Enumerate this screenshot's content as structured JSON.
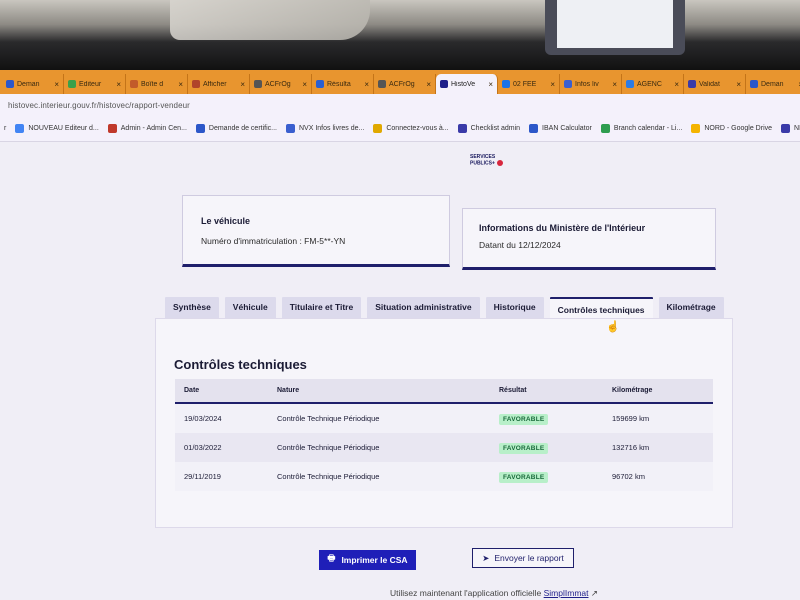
{
  "browser": {
    "tabs": [
      {
        "title": "Deman",
        "color": "#2c57c9"
      },
      {
        "title": "Editeur",
        "color": "#3aa04a"
      },
      {
        "title": "Boîte d",
        "color": "#c25b2a"
      },
      {
        "title": "Afficher",
        "color": "#b0442a"
      },
      {
        "title": "ACFrOg",
        "color": "#555555"
      },
      {
        "title": "Résulta",
        "color": "#2a5fd1"
      },
      {
        "title": "ACFrOg",
        "color": "#555555"
      },
      {
        "title": "HistoVe",
        "color": "#1f1f8a"
      },
      {
        "title": "02 FEE",
        "color": "#1a73e8"
      },
      {
        "title": "Infos liv",
        "color": "#3a5fcf"
      },
      {
        "title": "AGENC",
        "color": "#2c7be5"
      },
      {
        "title": "Validat",
        "color": "#3a3aa8"
      },
      {
        "title": "Deman",
        "color": "#2c57c9"
      }
    ],
    "url": "histovec.interieur.gouv.fr/histovec/rapport-vendeur",
    "bookmarks": [
      {
        "label": "r",
        "color": "#888888"
      },
      {
        "label": "NOUVEAU Editeur d...",
        "color": "#4285f4"
      },
      {
        "label": "Admin - Admin Cen...",
        "color": "#c0392b"
      },
      {
        "label": "Demande de certific...",
        "color": "#2c57c9"
      },
      {
        "label": "NVX Infos livres de...",
        "color": "#3a5fcf"
      },
      {
        "label": "Connectez-vous à...",
        "color": "#e0a800"
      },
      {
        "label": "Checklist admin",
        "color": "#3a3aa8"
      },
      {
        "label": "IBAN Calculator",
        "color": "#2c57c9"
      },
      {
        "label": "Branch calendar - Li...",
        "color": "#2e9d4f"
      },
      {
        "label": "NORD - Google Drive",
        "color": "#f4b400"
      },
      {
        "label": "NEWDemande va",
        "color": "#3a3aa8"
      }
    ]
  },
  "header": {
    "logo_line1": "SERVICES",
    "logo_line2": "PUBLICS+"
  },
  "vehicle_card": {
    "title": "Le véhicule",
    "registration": "Numéro d'immatriculation : FM-5**-YN"
  },
  "ministry_card": {
    "title": "Informations du Ministère de l'Intérieur",
    "date": "Datant du 12/12/2024"
  },
  "tabs": [
    "Synthèse",
    "Véhicule",
    "Titulaire et Titre",
    "Situation administrative",
    "Historique",
    "Contrôles techniques",
    "Kilométrage"
  ],
  "section_title": "Contrôles techniques",
  "table": {
    "headers": [
      "Date",
      "Nature",
      "Résultat",
      "Kilométrage"
    ],
    "rows": [
      {
        "date": "19/03/2024",
        "nature": "Contrôle Technique Périodique",
        "result": "FAVORABLE",
        "km": "159699 km"
      },
      {
        "date": "01/03/2022",
        "nature": "Contrôle Technique Périodique",
        "result": "FAVORABLE",
        "km": "132716 km"
      },
      {
        "date": "29/11/2019",
        "nature": "Contrôle Technique Périodique",
        "result": "FAVORABLE",
        "km": "96702 km"
      }
    ]
  },
  "actions": {
    "print_label": "Imprimer le CSA",
    "send_label": "Envoyer le rapport"
  },
  "footer": {
    "text": "Utilisez maintenant l'application officielle",
    "link": "SimplImmat"
  },
  "colors": {
    "tabbar": "#e8952f",
    "primary": "#1f1fb8",
    "badge_bg": "#b8efc9"
  }
}
